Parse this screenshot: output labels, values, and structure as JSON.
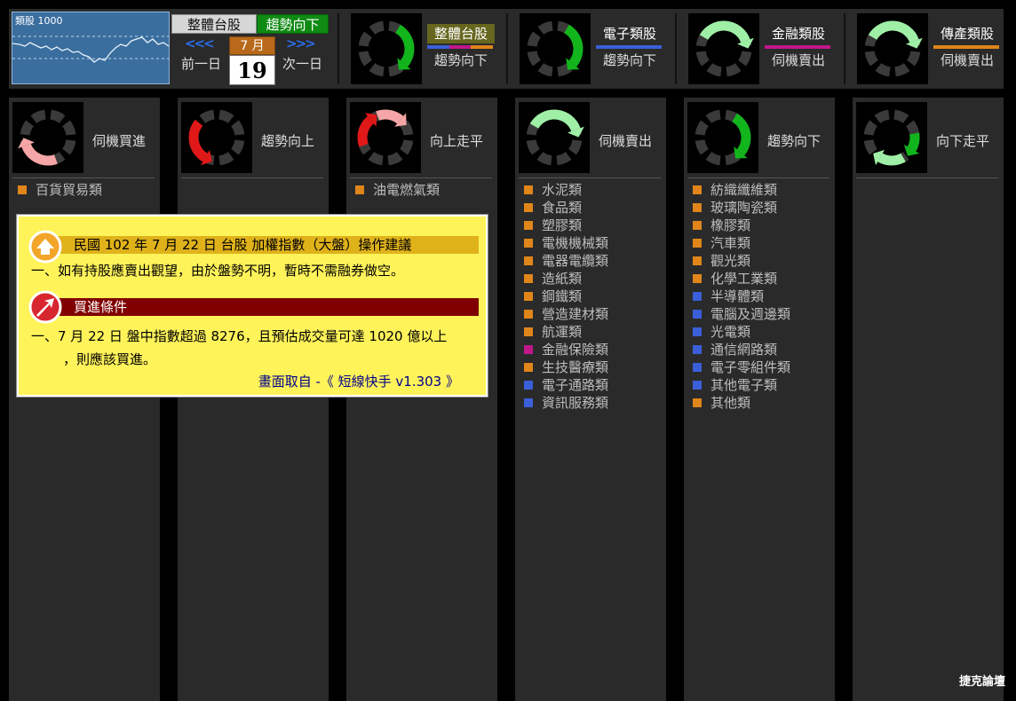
{
  "mini_chart": {
    "label": "類股 1000"
  },
  "market": {
    "name": "整體台股",
    "trend": "趨勢向下"
  },
  "date_nav": {
    "prev_arrows": "<<<",
    "next_arrows": ">>>",
    "prev_label": "前一日",
    "next_label": "次一日",
    "month": "7 月",
    "day": "19"
  },
  "groups": [
    {
      "name": "整體台股",
      "trend": "趨勢向下",
      "bar_color": "#3a5fd9",
      "bar_colors": [
        "#3a5fd9",
        "#c0178a",
        "#e0851a"
      ],
      "highlight": true,
      "icon": "cycle-down-icon"
    },
    {
      "name": "電子類股",
      "trend": "趨勢向下",
      "bar_color": "#3a5fd9",
      "icon": "cycle-down-icon"
    },
    {
      "name": "金融類股",
      "trend": "伺機賣出",
      "bar_color": "#c0178a",
      "icon": "cycle-sell-icon"
    },
    {
      "name": "傳產類股",
      "trend": "伺機賣出",
      "bar_color": "#e0851a",
      "icon": "cycle-sell-icon"
    }
  ],
  "columns": [
    {
      "title": "伺機買進",
      "icon": "cycle-buy-icon",
      "items": [
        {
          "label": "百貨貿易類",
          "color": "#e0851a"
        }
      ]
    },
    {
      "title": "趨勢向上",
      "icon": "cycle-up-icon",
      "items": []
    },
    {
      "title": "向上走平",
      "icon": "cycle-upflat-icon",
      "items": [
        {
          "label": "油電燃氣類",
          "color": "#e0851a"
        }
      ]
    },
    {
      "title": "伺機賣出",
      "icon": "cycle-sell-icon",
      "items": [
        {
          "label": "水泥類",
          "color": "#e0851a"
        },
        {
          "label": "食品類",
          "color": "#e0851a"
        },
        {
          "label": "塑膠類",
          "color": "#e0851a"
        },
        {
          "label": "電機機械類",
          "color": "#e0851a"
        },
        {
          "label": "電器電纜類",
          "color": "#e0851a"
        },
        {
          "label": "造紙類",
          "color": "#e0851a"
        },
        {
          "label": "鋼鐵類",
          "color": "#e0851a"
        },
        {
          "label": "營造建材類",
          "color": "#e0851a"
        },
        {
          "label": "航運類",
          "color": "#e0851a"
        },
        {
          "label": "金融保險類",
          "color": "#c0178a"
        },
        {
          "label": "生技醫療類",
          "color": "#e0851a"
        },
        {
          "label": "電子通路類",
          "color": "#3a5fd9"
        },
        {
          "label": "資訊服務類",
          "color": "#3a5fd9"
        }
      ]
    },
    {
      "title": "趨勢向下",
      "icon": "cycle-down-icon",
      "items": [
        {
          "label": "紡織纖維類",
          "color": "#e0851a"
        },
        {
          "label": "玻璃陶瓷類",
          "color": "#e0851a"
        },
        {
          "label": "橡膠類",
          "color": "#e0851a"
        },
        {
          "label": "汽車類",
          "color": "#e0851a"
        },
        {
          "label": "觀光類",
          "color": "#e0851a"
        },
        {
          "label": "化學工業類",
          "color": "#e0851a"
        },
        {
          "label": "半導體類",
          "color": "#3a5fd9"
        },
        {
          "label": "電腦及週邊類",
          "color": "#3a5fd9"
        },
        {
          "label": "光電類",
          "color": "#3a5fd9"
        },
        {
          "label": "通信網路類",
          "color": "#3a5fd9"
        },
        {
          "label": "電子零組件類",
          "color": "#3a5fd9"
        },
        {
          "label": "其他電子類",
          "color": "#3a5fd9"
        },
        {
          "label": "其他類",
          "color": "#e0851a"
        }
      ]
    },
    {
      "title": "向下走平",
      "icon": "cycle-downflat-icon",
      "items": []
    }
  ],
  "popup": {
    "title": "民國 102 年 7 月 22 日 台股 加權指數（大盤）操作建議",
    "line1": "一、如有持股應賣出觀望，由於盤勢不明，暫時不需融券做空。",
    "buy_title": "買進條件",
    "line2": "一、7 月 22 日 盤中指數超過 8276，且預估成交量可達 1020 億以上",
    "line3": "，則應該買進。",
    "source": "畫面取自 -《 短線快手 v1.303 》"
  },
  "watermark": "捷克論壇",
  "colors": {
    "green": "#12b51c",
    "light_green": "#9ff0a6",
    "red": "#e01818",
    "pink": "#f6a6a6",
    "market_trend_bg": "#0f8a12"
  }
}
